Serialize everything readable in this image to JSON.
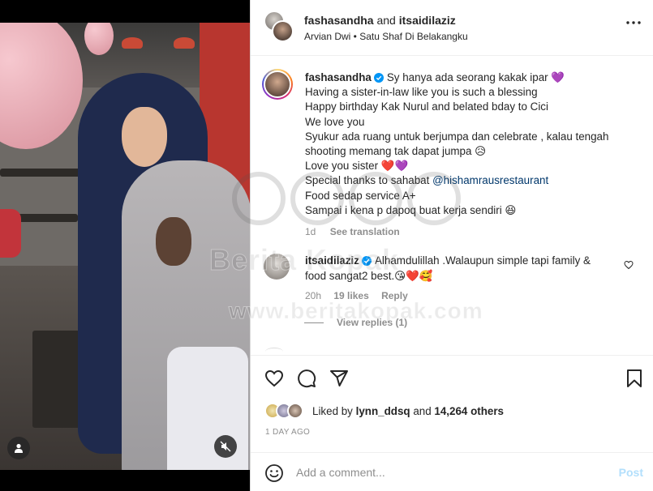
{
  "post": {
    "header": {
      "owner": "fashasandha",
      "connector": "and",
      "collaborator": "itsaidilaziz",
      "music": "Arvian Dwi • Satu Shaf Di Belakangku"
    },
    "caption": {
      "username": "fashasandha",
      "lines": [
        "Sy hanya ada seorang kakak ipar 💜",
        "Having a sister-in-law like you is such a blessing",
        "Happy birthday Kak Nurul and belated bday to Cici",
        "We love you",
        "Syukur ada ruang untuk berjumpa dan celebrate , kalau tengah",
        "shooting memang tak dapat jumpa 😥",
        "Love you sister ❤️💜"
      ],
      "thanks_prefix": "Special thanks to sahabat ",
      "thanks_mention": "@hishamrausrestaurant",
      "lines_after": [
        "Food sedap service A+",
        "Sampai i kena p dapoq buat kerja sendiri 😆"
      ],
      "age": "1d",
      "see_translation": "See translation"
    },
    "comments": [
      {
        "username": "itsaidilaziz",
        "text_line1": "Alhamdulillah .Walaupun simple tapi family &",
        "text_line2": "food sangat2 best.😘❤️🥰",
        "age": "20h",
        "likes": "19 likes",
        "reply": "Reply",
        "view_replies": "View replies (1)"
      }
    ],
    "likes": {
      "prefix": "Liked by",
      "user": "lynn_ddsq",
      "and": "and",
      "others": "14,264 others"
    },
    "time_ago": "1 DAY AGO",
    "add_comment": {
      "placeholder": "Add a comment...",
      "post_label": "Post"
    }
  },
  "watermark": {
    "line1": "Berita Kopak",
    "line2": "www.beritakopak.com"
  },
  "colors": {
    "link": "#00376b",
    "verified": "#0095f6",
    "post_disabled": "#b2dffc",
    "muted": "#8e8e8e",
    "heart": "#ed4956",
    "purple_heart": "#8a4fd6"
  },
  "icons": [
    "more-icon",
    "verified-icon",
    "heart-icon",
    "comment-icon",
    "share-icon",
    "bookmark-icon",
    "emoji-icon",
    "user-tag-icon",
    "mute-icon"
  ]
}
